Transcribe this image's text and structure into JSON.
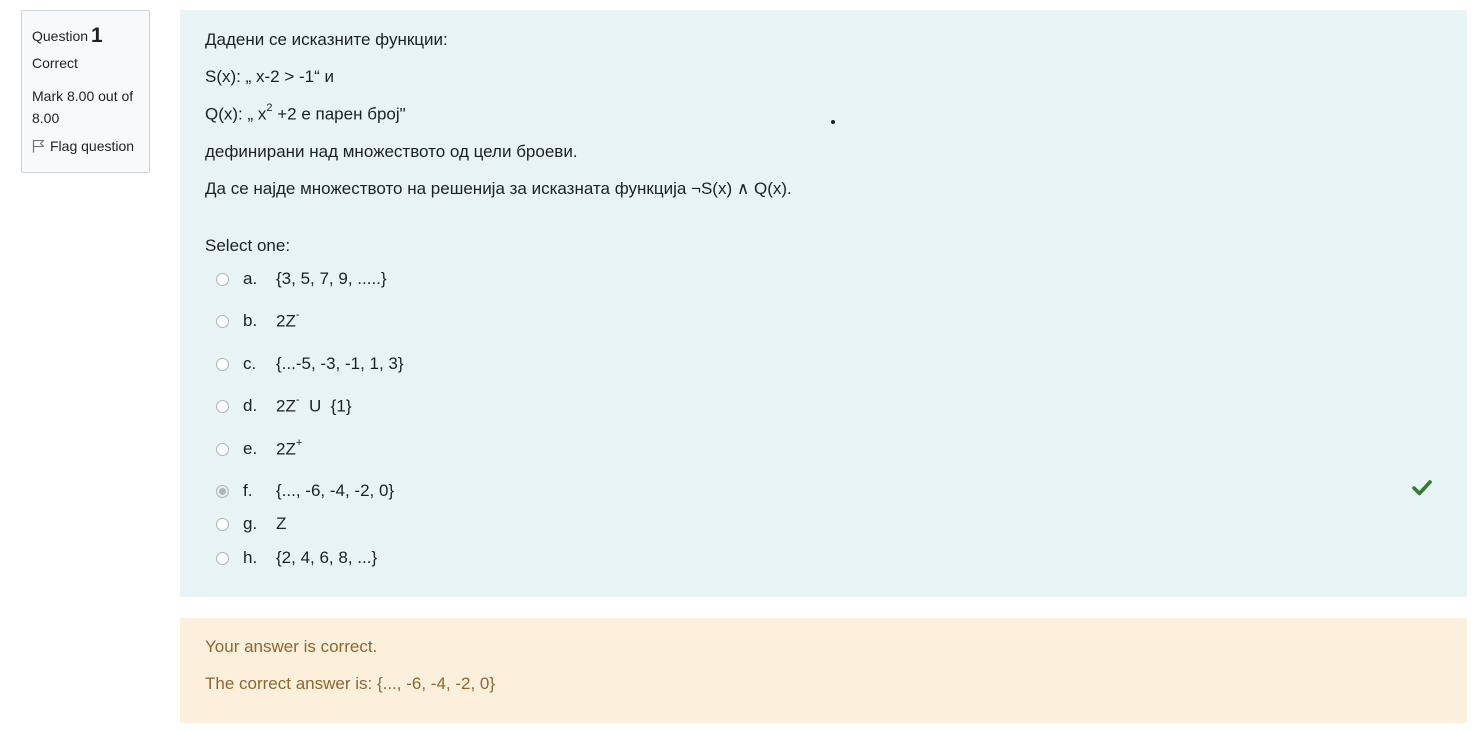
{
  "info": {
    "question_label": "Question",
    "question_number": "1",
    "state": "Correct",
    "grade": "Mark 8.00 out of 8.00",
    "flag_label": "Flag question"
  },
  "question": {
    "intro": "Дадени се исказните функции:",
    "s_def": "S(x): „ x-2 > -1“ и",
    "q_def_prefix": "Q(x): „ x",
    "q_def_sup": "2",
    "q_def_suffix": " +2 е парен број\"",
    "domain": "дефинирани над множеството од цели броеви.",
    "task": "Да се најде множеството на решенија за исказната функција ¬S(x) ∧ Q(x).",
    "prompt": "Select one:"
  },
  "options": [
    {
      "letter": "a.",
      "text": "{3, 5, 7, 9, .....}",
      "sup": "",
      "tail": "",
      "checked": false
    },
    {
      "letter": "b.",
      "text": "2Z",
      "sup": "-",
      "tail": "",
      "checked": false
    },
    {
      "letter": "c.",
      "text": "{...-5, -3, -1, 1, 3}",
      "sup": "",
      "tail": "",
      "checked": false
    },
    {
      "letter": "d.",
      "text": "2Z",
      "sup": "-",
      "tail": "  U  {1}",
      "checked": false
    },
    {
      "letter": "e.",
      "text": "2Z",
      "sup": "+",
      "tail": "",
      "checked": false
    },
    {
      "letter": "f.",
      "text": "{..., -6, -4, -2, 0}",
      "sup": "",
      "tail": "",
      "checked": true
    },
    {
      "letter": "g.",
      "text": "Z",
      "sup": "",
      "tail": "",
      "checked": false
    },
    {
      "letter": "h.",
      "text": "{2, 4, 6, 8, ...}",
      "sup": "",
      "tail": "",
      "checked": false
    }
  ],
  "feedback": {
    "result": "Your answer is correct.",
    "correct_answer": "The correct answer is: {..., -6, -4, -2, 0}"
  },
  "colors": {
    "question_bg": "#e7f3f5",
    "feedback_bg": "#fcefdc",
    "feedback_text": "#8e662e",
    "check_icon": "#357a32"
  }
}
